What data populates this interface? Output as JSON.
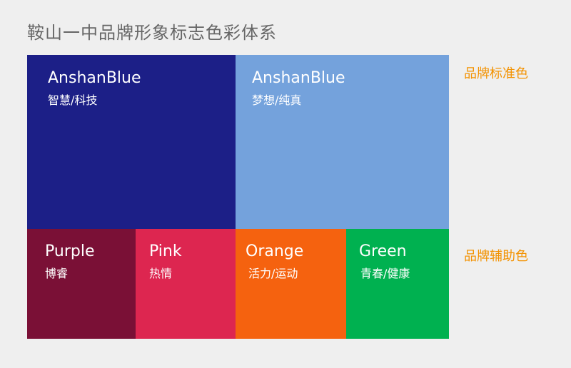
{
  "title": "鞍山一中品牌形象标志色彩体系",
  "labels": {
    "standard": "品牌标准色",
    "auxiliary": "品牌辅助色"
  },
  "standard_colors": [
    {
      "name": "AnshanBlue",
      "desc": "智慧/科技",
      "color": "#1c1f87"
    },
    {
      "name": "AnshanBlue",
      "desc": "梦想/纯真",
      "color": "#74a2dc"
    }
  ],
  "auxiliary_colors": [
    {
      "name": "Purple",
      "desc": "博睿",
      "color": "#7a1036"
    },
    {
      "name": "Pink",
      "desc": "热情",
      "color": "#dd2650"
    },
    {
      "name": "Orange",
      "desc": "活力/运动",
      "color": "#f5620f"
    },
    {
      "name": "Green",
      "desc": "青春/健康",
      "color": "#00b150"
    }
  ],
  "label_color": "#f39200"
}
